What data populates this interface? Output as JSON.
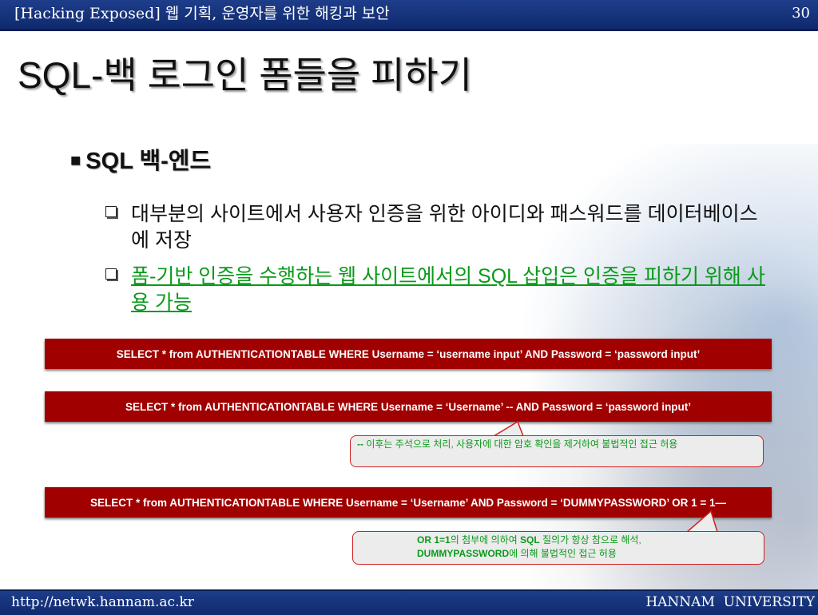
{
  "header": {
    "title": "[Hacking Exposed] 웹 기획, 운영자를 위한 해킹과 보안",
    "page_number": "30"
  },
  "slide": {
    "heading": "SQL-백 로그인 폼들을 피하기",
    "bullet_marker": "■",
    "bullet": "SQL 백-엔드",
    "sub_bullets": [
      "대부분의 사이트에서 사용자 인증을 위한 아이디와 패스워드를 데이터베이스에 저장",
      "폼-기반 인증을 수행하는 웹 사이트에서의 SQL 삽입은 인증을 피하기 위해 사용 가능"
    ],
    "sql": [
      "SELECT * from AUTHENTICATIONTABLE WHERE Username = ‘username input’ AND Password = ‘password input’",
      "SELECT * from AUTHENTICATIONTABLE WHERE Username = ‘Username’  --  AND Password = ‘password input’",
      "SELECT * from AUTHENTICATIONTABLE WHERE Username = ‘Username’ AND Password = ‘DUMMYPASSWORD’ OR 1 = 1—"
    ],
    "callout1": {
      "bold": "--",
      "text": " 이후는 주석으로 처리, 사용자에 대한 암호 확인을 제거하여 불법적인 접근 허용"
    },
    "callout2": {
      "bold1": "OR 1=1",
      "text1": "의 첨부에 의하여 ",
      "bold2": "SQL",
      "text2": " 질의가 항상 참으로 해석,",
      "bold3": "DUMMYPASSWORD",
      "text3": "에 의해 불법적인 접근 허용"
    }
  },
  "footer": {
    "url": "http://netwk.hannam.ac.kr",
    "university": "HANNAM  UNIVERSITY"
  },
  "colors": {
    "banner": "#0f2a6e",
    "sql_bar": "#a00000",
    "green_text": "#0a9a1a",
    "callout_border": "#d02020"
  }
}
